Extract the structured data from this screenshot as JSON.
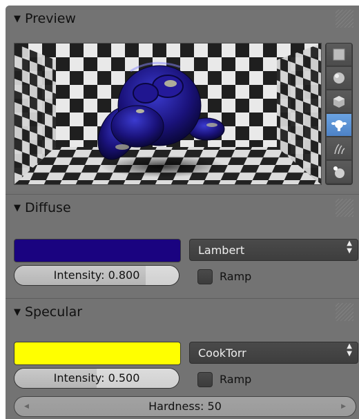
{
  "preview": {
    "title": "Preview",
    "shapes": [
      {
        "name": "flat-plane-icon",
        "active": false
      },
      {
        "name": "sphere-icon",
        "active": false
      },
      {
        "name": "cube-icon",
        "active": false
      },
      {
        "name": "monkey-icon",
        "active": true
      },
      {
        "name": "hair-strands-icon",
        "active": false
      },
      {
        "name": "world-sphere-icon",
        "active": false
      }
    ]
  },
  "diffuse": {
    "title": "Diffuse",
    "color": "#1a0380",
    "shader": "Lambert",
    "intensity_label": "Intensity: 0.800",
    "intensity_value": 0.8,
    "ramp_label": "Ramp"
  },
  "specular": {
    "title": "Specular",
    "color": "#ffff00",
    "shader": "CookTorr",
    "intensity_label": "Intensity: 0.500",
    "intensity_value": 0.5,
    "ramp_label": "Ramp",
    "hardness_label": "Hardness: 50"
  }
}
